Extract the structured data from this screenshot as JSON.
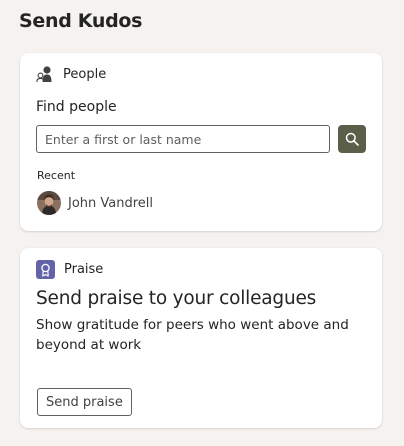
{
  "page": {
    "title": "Send Kudos"
  },
  "people_card": {
    "header_label": "People",
    "header_icon": "people-icon",
    "find_label": "Find people",
    "search": {
      "placeholder": "Enter a first or last name",
      "value": "",
      "button_icon": "search-icon"
    },
    "recent_label": "Recent",
    "recent": [
      {
        "name": "John Vandrell",
        "avatar": "avatar-photo"
      }
    ]
  },
  "praise_card": {
    "header_label": "Praise",
    "header_icon": "badge-icon",
    "heading": "Send praise to your colleagues",
    "description": "Show gratitude for peers who went above and beyond at work",
    "button_label": "Send praise"
  },
  "colors": {
    "background": "#f5f2ef",
    "card": "#ffffff",
    "search_button": "#5b5f4a",
    "praise_icon": "#6264a7"
  }
}
